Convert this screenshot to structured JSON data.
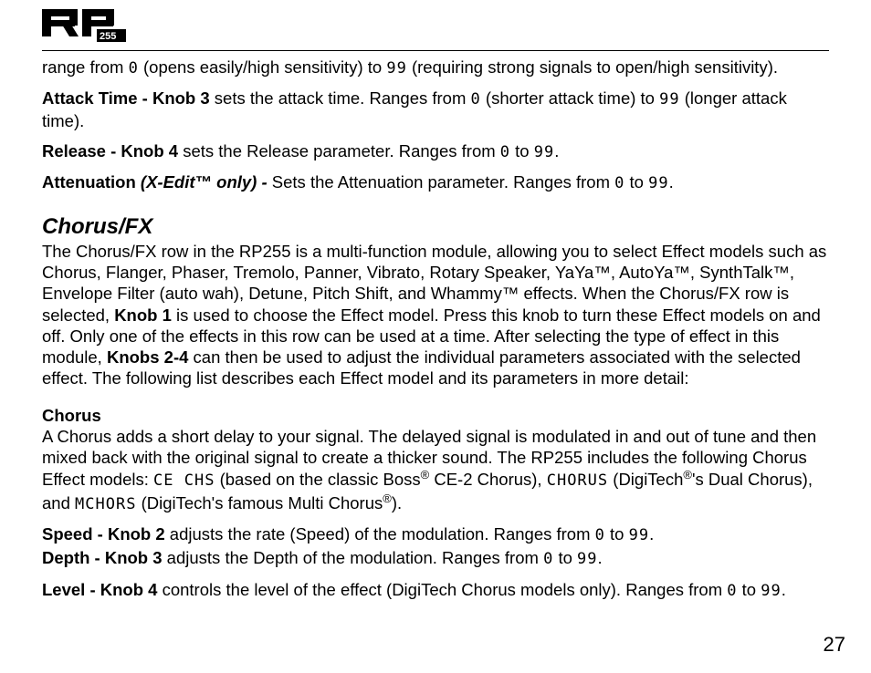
{
  "logo": {
    "num": "255"
  },
  "p1": {
    "t1": "range from ",
    "v0": "0",
    "t2": " (opens easily/high sensitivity) to ",
    "v99": "99",
    "t3": " (requiring strong signals to open/high sensitivity)."
  },
  "p2": {
    "label": "Attack Time - Knob 3",
    "t1": " sets the attack time.  Ranges from ",
    "v0": "0",
    "t2": " (shorter attack time) to ",
    "v99": "99",
    "t3": " (longer attack time)."
  },
  "p3": {
    "label": "Release - Knob 4",
    "t1": " sets the Release parameter. Ranges from ",
    "v0": "0",
    "t2": " to ",
    "v99": "99",
    "t3": "."
  },
  "p4": {
    "label1": "Attenuation ",
    "label2": "(X-Edit™ only) - ",
    "t1": "Sets the Attenuation parameter. Ranges from ",
    "v0": "0",
    "t2": " to ",
    "v99": "99",
    "t3": "."
  },
  "section": {
    "title": "Chorus/FX"
  },
  "p5": {
    "t1": "The Chorus/FX row in the RP255 is a multi-function module, allowing you to select Effect models such as Chorus, Flanger,  Phaser,  Tremolo,  Panner,  Vibrato,  Rotary Speaker,  YaYa™,  AutoYa™, SynthTalk™, Envelope Filter (auto wah),  Detune,  Pitch Shift,  and Whammy™ effects. When the Chorus/FX row is selected, ",
    "kb1": "Knob 1",
    "t2": " is used to choose the Effect model. Press this knob to turn these Effect models on and off.  Only one of the effects in this row can be used at a time.  After selecting the type of effect in this module, ",
    "kb24": "Knobs 2-4",
    "t3": " can then be used to adjust the individual parameters associated with the selected effect.  The following list describes each Effect model and its parameters in more detail:"
  },
  "chorus": {
    "heading": "Chorus",
    "t1": "A Chorus adds a short delay to your signal.  The delayed signal is modulated in and out of tune and then mixed back with the original signal to create a thicker sound.  The RP255 includes the following Chorus Effect models: ",
    "m1": "CE  CHS",
    "t2": " (based on the classic Boss",
    "reg1": "®",
    "t3": " CE-2 Chorus), ",
    "m2": "CHORUS",
    "t4": " (DigiTech",
    "reg2": "®",
    "t5": "'s Dual Chorus), and ",
    "m3": "MCHORS",
    "t6": " (DigiTech's famous Multi Chorus",
    "reg3": "®",
    "t7": ")."
  },
  "p6": {
    "label": "Speed - Knob 2",
    "t1": " adjusts the rate (Speed) of the modulation.  Ranges from ",
    "v0": "0",
    "t2": " to ",
    "v99": "99",
    "t3": "."
  },
  "p7": {
    "label": "Depth - Knob 3",
    "t1": " adjusts the Depth of the modulation.  Ranges from ",
    "v0": "0",
    "t2": " to ",
    "v99": "99",
    "t3": "."
  },
  "p8": {
    "label": "Level - Knob 4",
    "t1": " controls the level of the effect (DigiTech Chorus models only).  Ranges from ",
    "v0": "0",
    "t2": " to ",
    "v99": "99",
    "t3": "."
  },
  "page_number": "27"
}
